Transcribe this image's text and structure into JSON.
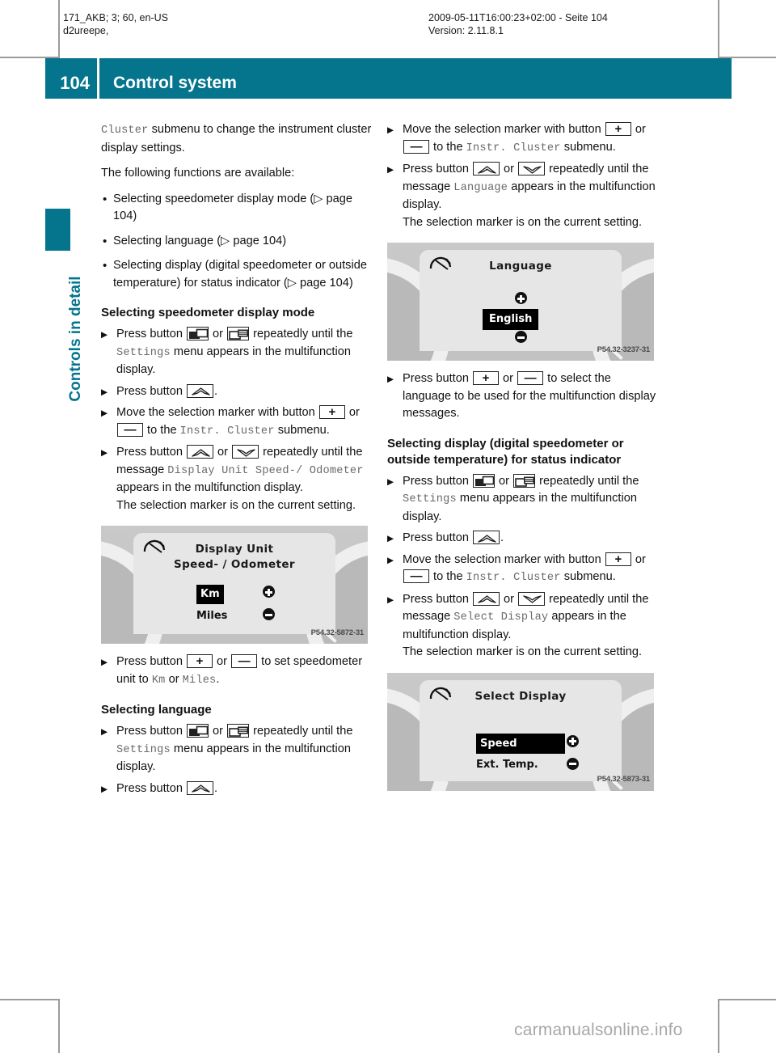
{
  "meta": {
    "left_line1": "171_AKB; 3; 60, en-US",
    "left_line2": "d2ureepe,",
    "right_line1": "2009-05-11T16:00:23+02:00 - Seite 104",
    "right_line2": "Version: 2.11.8.1"
  },
  "banner": {
    "page_number": "104",
    "title": "Control system",
    "color": "#05748d"
  },
  "sidebar": {
    "chapter_label": "Controls in detail"
  },
  "left_column": {
    "intro": {
      "mono_lead": "Cluster",
      "text_after": " submenu to change the instrument cluster display settings.",
      "line2": "The following functions are available:"
    },
    "bullets": [
      {
        "marker": "•",
        "text": "Selecting speedometer display mode (▷ page 104)"
      },
      {
        "marker": "•",
        "text": "Selecting language (▷ page 104)"
      },
      {
        "marker": "•",
        "text": "Selecting display (digital speedometer or outside temperature) for status indicator (▷ page 104)"
      }
    ],
    "section1": {
      "heading": "Selecting speedometer display mode",
      "step1_a": "Press button ",
      "step1_or": " or ",
      "step1_b": " repeatedly until the ",
      "step1_mono": "Settings",
      "step1_c": " menu appears in the multifunction display.",
      "step2_a": "Press button ",
      "step2_b": ".",
      "step3_a": "Move the selection marker with button ",
      "step3_or": " or ",
      "step3_b": " to the ",
      "step3_mono": "Instr. Cluster",
      "step3_c": " submenu.",
      "step4_a": "Press button ",
      "step4_or": " or ",
      "step4_b": " repeatedly until the message ",
      "step4_mono": "Display Unit Speed-/ Odometer",
      "step4_c": " appears in the multifunction display.",
      "step4_note": "The selection marker is on the current setting.",
      "step5_a": "Press button ",
      "step5_or": " or ",
      "step5_b": " to set speedometer unit to ",
      "step5_mono1": "Km",
      "step5_mid": " or ",
      "step5_mono2": "Miles",
      "step5_c": "."
    },
    "figure1": {
      "title": "Display Unit",
      "title2": "Speed- / Odometer",
      "option_selected": "Km",
      "option_other": "Miles",
      "caption": "P54.32-5872-31"
    },
    "section2": {
      "heading": "Selecting language",
      "step1_a": "Press button ",
      "step1_or": " or ",
      "step1_b": " repeatedly until the ",
      "step1_mono": "Settings",
      "step1_c": " menu appears in the multifunction display.",
      "step2_a": "Press button ",
      "step2_b": "."
    }
  },
  "right_column": {
    "section_lang": {
      "step1_a": "Move the selection marker with button ",
      "step1_or": " or ",
      "step1_b": " to the ",
      "step1_mono": "Instr. Cluster",
      "step1_c": " submenu.",
      "step2_a": "Press button ",
      "step2_or": " or ",
      "step2_b": " repeatedly until the message ",
      "step2_mono": "Language",
      "step2_c": " appears in the multifunction display.",
      "step2_note": "The selection marker is on the current setting.",
      "step3_a": "Press button ",
      "step3_or": " or ",
      "step3_b": " to select the language to be used for the multifunction display messages."
    },
    "figure2": {
      "title": "Language",
      "option_selected": "English",
      "caption": "P54.32-3237-31"
    },
    "section3": {
      "heading_line1": "Selecting display (digital speedometer or",
      "heading_line2": "outside temperature) for status indicator",
      "step1_a": "Press button ",
      "step1_or": " or ",
      "step1_b": " repeatedly until the ",
      "step1_mono": "Settings",
      "step1_c": " menu appears in the multifunction display.",
      "step2_a": "Press button ",
      "step2_b": ".",
      "step3_a": "Move the selection marker with button ",
      "step3_or": " or ",
      "step3_b": " to the ",
      "step3_mono": "Instr. Cluster",
      "step3_c": " submenu.",
      "step4_a": "Press button ",
      "step4_or": " or ",
      "step4_b": " repeatedly until the message ",
      "step4_mono": "Select Display",
      "step4_c": " appears in the multifunction display.",
      "step4_note": "The selection marker is on the current setting."
    },
    "figure3": {
      "title": "Select Display",
      "option_selected": "Speed",
      "option_other": "Ext. Temp.",
      "caption": "P54.32-5873-31"
    }
  },
  "footer": {
    "watermark": "carmanualsonline.info"
  },
  "glyphs": {
    "plus": "+",
    "minus": "—",
    "arrow_bullet": "▶"
  }
}
